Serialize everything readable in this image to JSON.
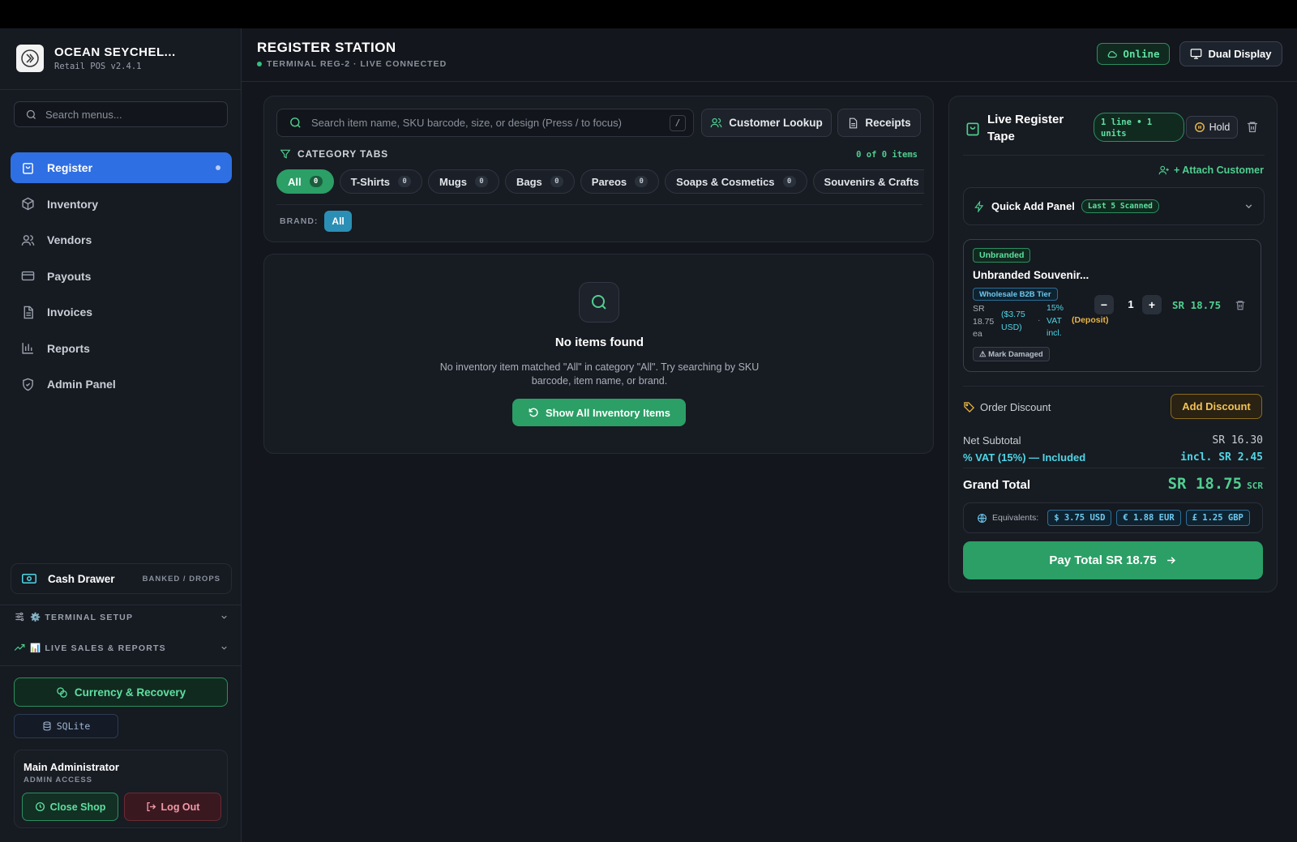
{
  "app": {
    "brand_name": "OCEAN SEYCHEL...",
    "version": "Retail POS v2.4.1",
    "logo_icon": "shop-logo-icon"
  },
  "sidebar": {
    "search_placeholder": "Search menus...",
    "items": [
      {
        "label": "Register",
        "icon": "register-bag-icon",
        "active": true
      },
      {
        "label": "Inventory",
        "icon": "box-icon"
      },
      {
        "label": "Vendors",
        "icon": "users-icon"
      },
      {
        "label": "Payouts",
        "icon": "card-icon"
      },
      {
        "label": "Invoices",
        "icon": "document-icon"
      },
      {
        "label": "Reports",
        "icon": "bar-chart-icon"
      },
      {
        "label": "Admin Panel",
        "icon": "shield-icon"
      }
    ],
    "cash_drawer": {
      "label": "Cash Drawer",
      "tag": "BANKED / DROPS"
    },
    "terminal_setup": "⚙️ TERMINAL SETUP",
    "live_sales": "📊 LIVE SALES & REPORTS",
    "currency_button": "Currency & Recovery",
    "db_badge": "SQLite",
    "user": {
      "name": "Main Administrator",
      "role": "ADMIN ACCESS"
    },
    "close_shop": "Close Shop",
    "log_out": "Log Out"
  },
  "header": {
    "title": "REGISTER STATION",
    "subtitle": "TERMINAL REG-2 · LIVE CONNECTED",
    "online": "Online",
    "dual_display": "Dual Display"
  },
  "search": {
    "placeholder": "Search item name, SKU barcode, size, or design (Press / to focus)",
    "shortcut": "/",
    "customer_lookup": "Customer Lookup",
    "receipts": "Receipts",
    "category_header": "CATEGORY TABS",
    "item_count": "0 of 0 items",
    "tabs": [
      {
        "label": "All",
        "count": "0",
        "active": true
      },
      {
        "label": "T-Shirts",
        "count": "0"
      },
      {
        "label": "Mugs",
        "count": "0"
      },
      {
        "label": "Bags",
        "count": "0"
      },
      {
        "label": "Pareos",
        "count": "0"
      },
      {
        "label": "Soaps & Cosmetics",
        "count": "0"
      },
      {
        "label": "Souvenirs & Crafts",
        "count": ""
      }
    ],
    "brand_label": "BRAND:",
    "brand_value": "All"
  },
  "empty": {
    "title": "No items found",
    "description": "No inventory item matched \"All\" in category \"All\". Try searching by SKU barcode, item name, or brand.",
    "button": "Show All Inventory Items"
  },
  "tape": {
    "title": "Live Register Tape",
    "lines_badge": "1 line • 1 units",
    "hold": "Hold",
    "attach_customer": "+ Attach Customer",
    "quick_add": "Quick Add Panel",
    "quick_badge": "Last 5 Scanned",
    "item": {
      "brand": "Unbranded",
      "name": "Unbranded Souvenir...",
      "tier": "Wholesale B2B Tier",
      "price_sr": "SR 18.75 ea",
      "price_usd": "($3.75 USD)",
      "separator": "·",
      "vat": "15% VAT incl.",
      "deposit": "(Deposit)",
      "qty": "1",
      "minus": "−",
      "plus": "+",
      "total": "SR 18.75",
      "mark_damaged": "⚠ Mark Damaged"
    },
    "order_discount": "Order Discount",
    "add_discount": "Add Discount",
    "net_subtotal_label": "Net Subtotal",
    "net_subtotal_value": "SR 16.30",
    "vat_label": "% VAT (15%) — Included",
    "vat_value": "incl. SR 2.45",
    "grand_total_label": "Grand Total",
    "grand_total_value": "SR 18.75",
    "grand_total_currency": "SCR",
    "equivalents_label": "Equivalents:",
    "equivalents": [
      "$ 3.75 USD",
      "€ 1.88 EUR",
      "£ 1.25 GBP"
    ],
    "pay_button": "Pay Total SR 18.75"
  },
  "colors": {
    "accent_blue": "#2f6fe4",
    "accent_green": "#2b9f66",
    "text_green": "#4fcf8f",
    "cyan": "#4fd6e6",
    "amber": "#f2c257",
    "bg": "#13161c"
  }
}
